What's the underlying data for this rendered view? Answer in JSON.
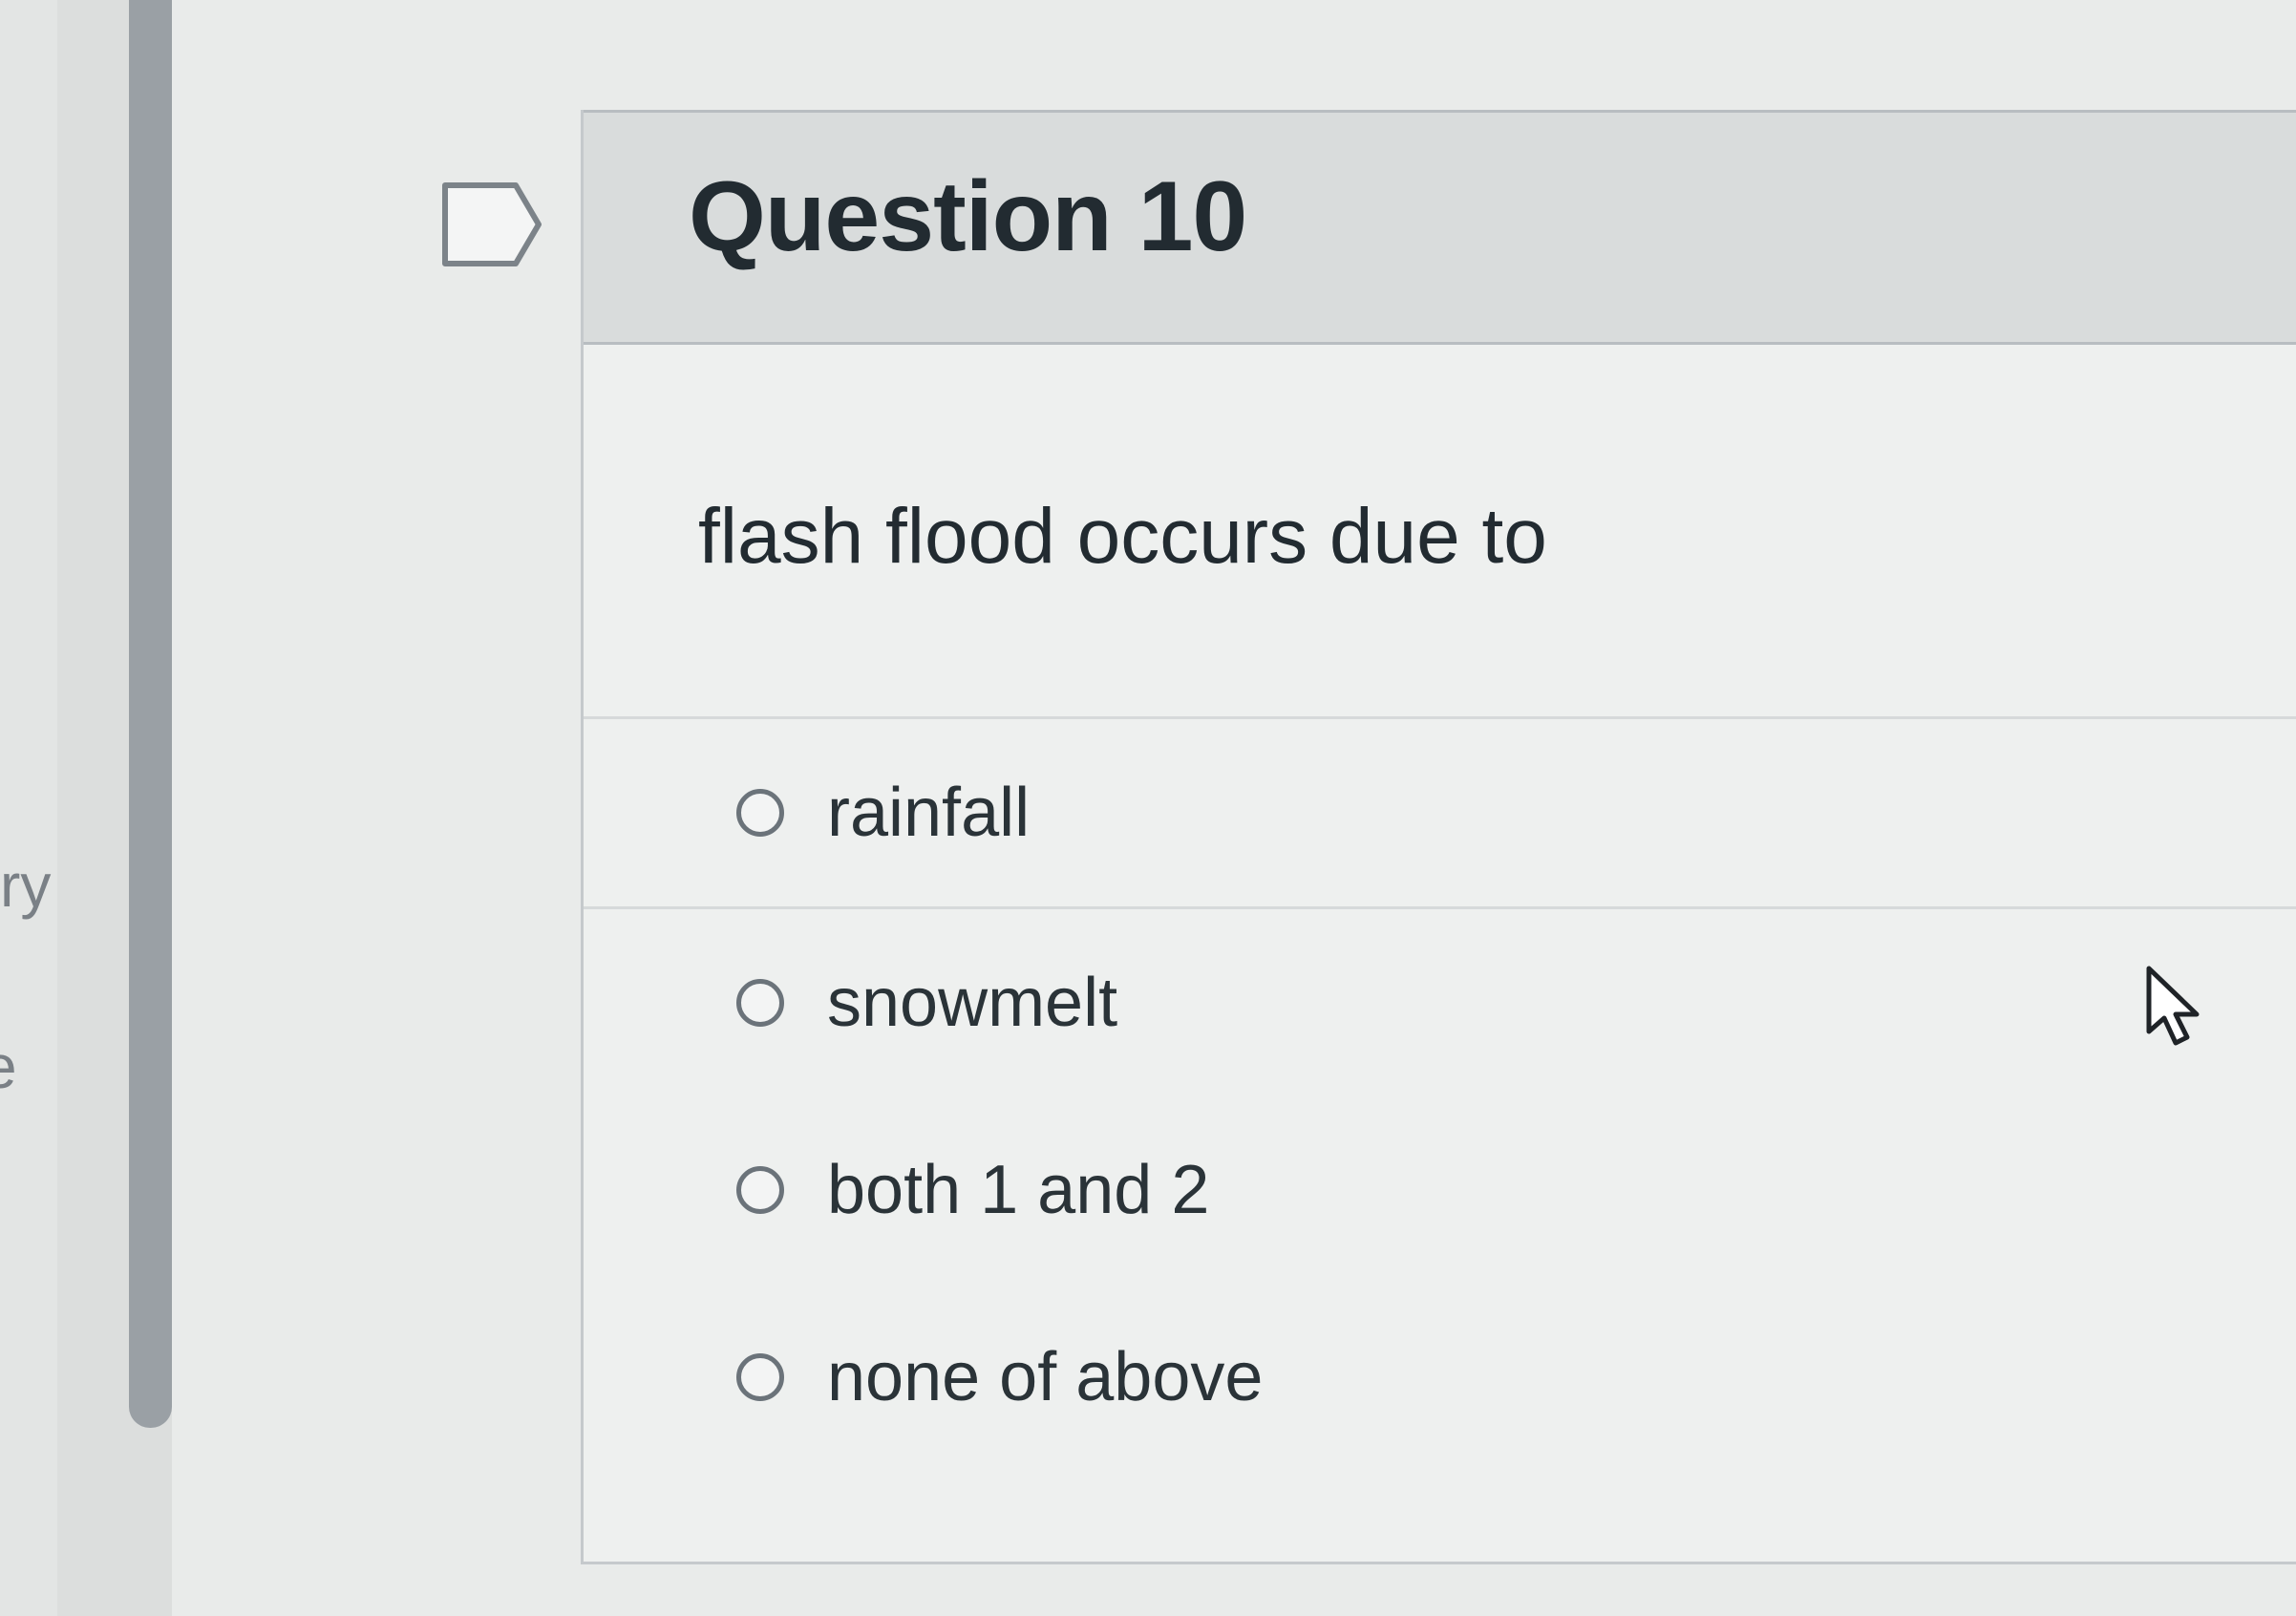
{
  "sidebar": {
    "fragments": [
      "ry",
      "e"
    ]
  },
  "question": {
    "title": "Question 10",
    "text": "flash flood occurs due to",
    "flag_icon": "flag-bookmark-icon",
    "answers": [
      {
        "label": "rainfall",
        "selected": false
      },
      {
        "label": "snowmelt",
        "selected": false
      },
      {
        "label": "both 1 and 2",
        "selected": false
      },
      {
        "label": "none of above",
        "selected": false
      }
    ]
  },
  "cursor_icon": "pointer-arrow-icon",
  "colors": {
    "background": "#e9ebea",
    "header": "#d9dcdc",
    "text": "#222b31",
    "radio_border": "#6b737a",
    "scrollbar": "#9aa0a5"
  }
}
